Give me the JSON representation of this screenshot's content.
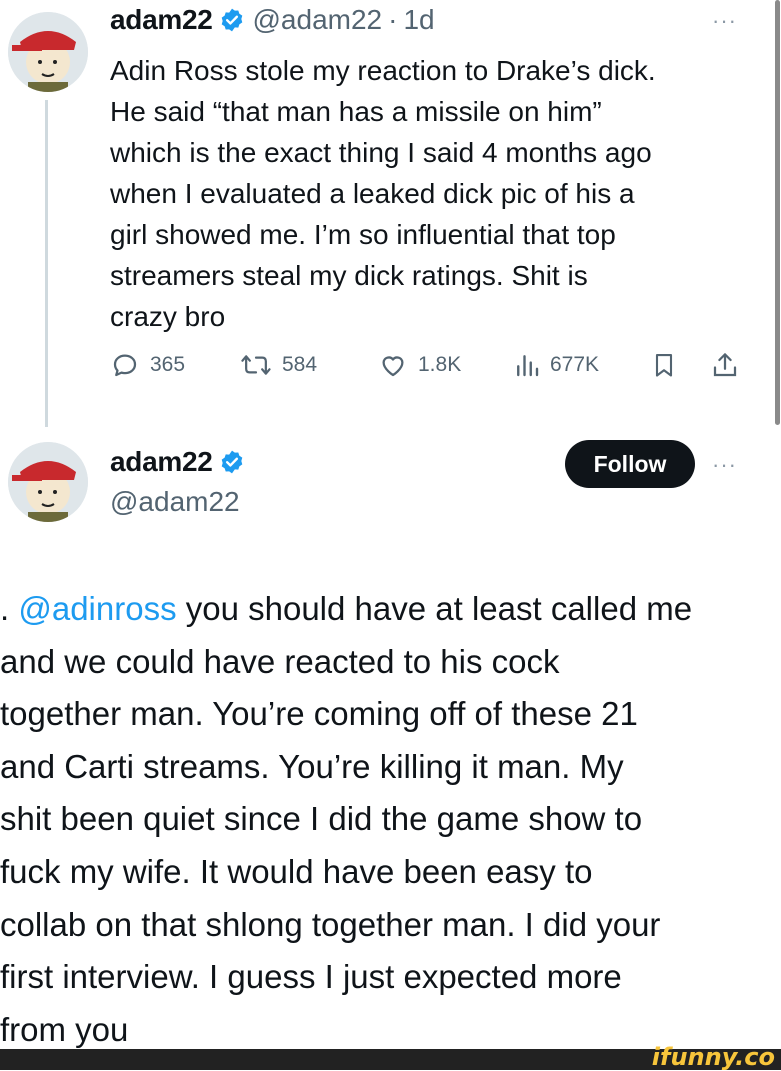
{
  "first_tweet": {
    "name": "adam22",
    "handle": "@adam22",
    "separator": "·",
    "time": "1d",
    "more": "···",
    "text": "Adin Ross stole my reaction to Drake’s dick.\nHe said “that man has a missile on him”\nwhich is the exact thing I said 4 months ago\nwhen I evaluated a leaked dick pic of his a\ngirl showed me. I’m so influential that top\nstreamers steal my dick ratings. Shit is\ncrazy bro",
    "metrics": {
      "replies": "365",
      "reposts": "584",
      "likes": "1.8K",
      "views": "677K"
    }
  },
  "second_tweet": {
    "name": "adam22",
    "handle": "@adam22",
    "follow_label": "Follow",
    "more": "···",
    "text_prefix": ". ",
    "mention": "@adinross",
    "text_rest": " you should have at least called me\nand we could have reacted to his cock\ntogether man. You’re coming off of these 21\nand Carti streams. You’re killing it man. My\nshit been quiet since I did the game show to\nfuck my wife. It would have been easy to\ncollab on that shlong together man. I did your\nfirst interview. I guess I just expected more\nfrom you"
  },
  "watermark": "ifunny.co",
  "colors": {
    "text": "#0f1419",
    "secondary": "#536471",
    "accent": "#1d9bf0",
    "follow_bg": "#0f1419",
    "verified": "#1d9bf0"
  },
  "icons": [
    "reply-icon",
    "repost-icon",
    "like-icon",
    "views-icon",
    "bookmark-icon",
    "share-icon",
    "verified-icon"
  ]
}
